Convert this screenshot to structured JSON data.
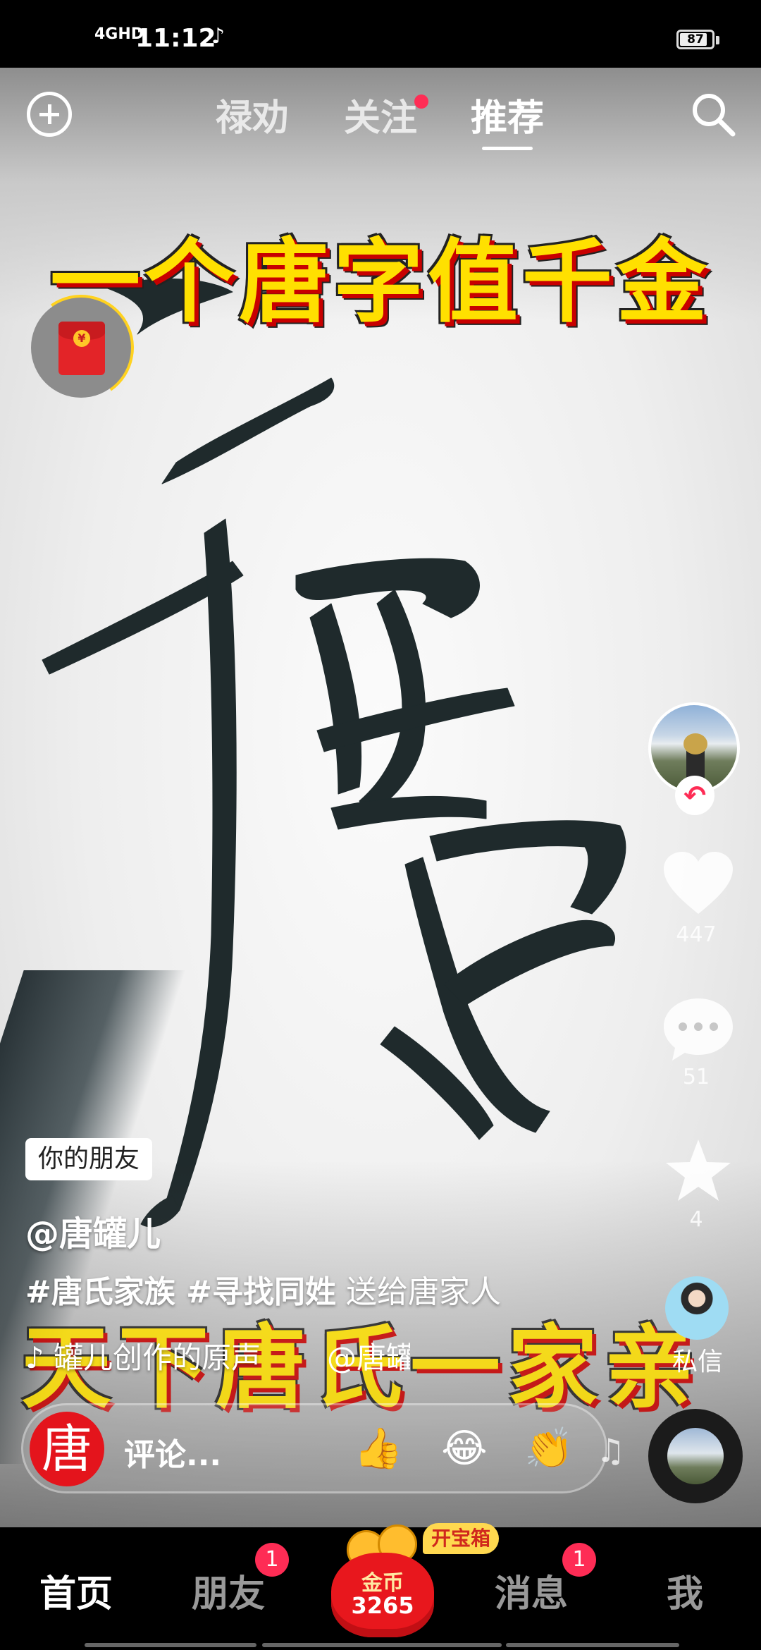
{
  "status_bar": {
    "network": "4GHD",
    "time": "11:12",
    "battery": "87",
    "battery_level": 0.87
  },
  "top_nav": {
    "tabs": [
      {
        "label": "禄劝",
        "active": false
      },
      {
        "label": "关注",
        "active": false,
        "dot": true
      },
      {
        "label": "推荐",
        "active": true
      }
    ]
  },
  "video": {
    "headline_top": "一个唐字值千金",
    "headline_bottom": "天下唐氏一家亲"
  },
  "right_rail": {
    "like_count": "447",
    "comment_count": "51",
    "favorite_count": "4",
    "dm_label": "私信"
  },
  "caption": {
    "friend_tag": "你的朋友",
    "author": "@唐罐儿",
    "hashtags": "#唐氏家族 #寻找同姓",
    "text": " 送给唐家人",
    "music": "罐儿创作的原声",
    "music_credit": "@唐罐儿"
  },
  "comment_bar": {
    "avatar_char": "唐",
    "placeholder": "评论..."
  },
  "bottom_nav": {
    "home": "首页",
    "friends": "朋友",
    "friends_badge": "1",
    "coins_label": "金币",
    "coins_count": "3265",
    "treasure_tag": "开宝箱",
    "messages": "消息",
    "messages_badge": "1",
    "me": "我"
  },
  "colors": {
    "accent": "#fe2c55",
    "headline_fill": "#ffe000",
    "headline_shadow": "#c80000"
  }
}
